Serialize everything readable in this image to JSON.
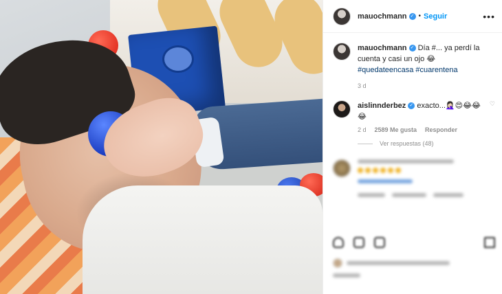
{
  "post": {
    "username": "mauochmann",
    "follow_label": "Seguir",
    "more_label": "•••",
    "dot": "•"
  },
  "caption": {
    "username": "mauochmann",
    "text": "Día #... ya perdí la cuenta y casi un ojo 😂",
    "hashtags": "#quedateencasa #cuarentena",
    "time": "3 d"
  },
  "comment": {
    "username": "aislinnderbez",
    "text": "exacto...🤦🏻‍♀️😍😂😂😂",
    "time": "2 d",
    "likes": "2589 Me gusta",
    "reply_label": "Responder",
    "view_replies": "Ver respuestas (48)",
    "heart": "♡"
  },
  "icons": {
    "verified": "verified-badge",
    "more": "more-icon",
    "heart": "heart-icon"
  },
  "colors": {
    "link": "#0095f6",
    "hashtag": "#00376b",
    "secondary_text": "#8e8e8e",
    "verified": "#3897f0"
  }
}
